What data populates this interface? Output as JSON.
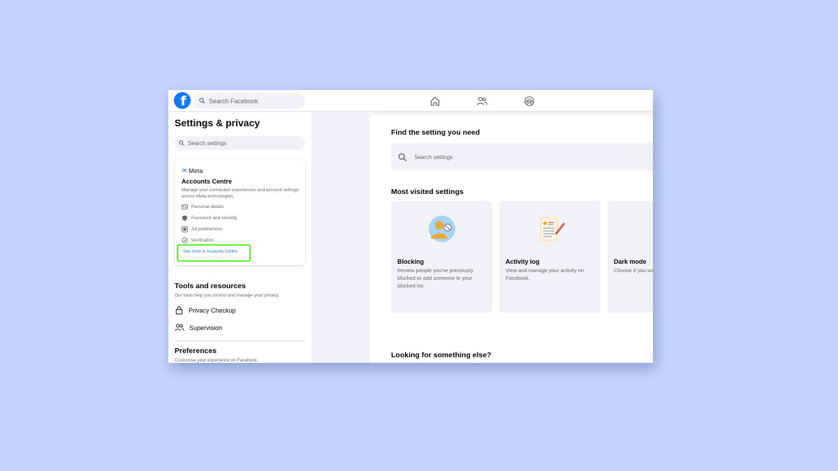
{
  "topbar": {
    "logo_letter": "f",
    "search_placeholder": "Search Facebook",
    "nav_icons": [
      "home-icon",
      "friends-icon",
      "groups-icon"
    ]
  },
  "sidebar": {
    "title": "Settings & privacy",
    "search_placeholder": "Search settings",
    "accounts_centre": {
      "brand": "Meta",
      "title": "Accounts Centre",
      "description": "Manage your connected experiences and account settings across Meta technologies.",
      "items": [
        {
          "label": "Personal details",
          "icon": "id-card-icon"
        },
        {
          "label": "Password and security",
          "icon": "shield-icon"
        },
        {
          "label": "Ad preferences",
          "icon": "ad-icon"
        },
        {
          "label": "Verification",
          "icon": "check-circle-icon"
        }
      ],
      "link": "See more in Accounts Centre"
    },
    "tools": {
      "title": "Tools and resources",
      "subtitle": "Our tools help you control and manage your privacy.",
      "items": [
        {
          "label": "Privacy Checkup",
          "icon": "lock-icon"
        },
        {
          "label": "Supervision",
          "icon": "people-icon"
        }
      ]
    },
    "preferences": {
      "title": "Preferences",
      "subtitle": "Customise your experience on Facebook."
    }
  },
  "main": {
    "find_title": "Find the setting you need",
    "search_placeholder": "Search settings",
    "most_visited_title": "Most visited settings",
    "cards": [
      {
        "title": "Blocking",
        "description": "Review people you've previously blocked or add someone to your blocked list."
      },
      {
        "title": "Activity log",
        "description": "View and manage your activity on Facebook."
      },
      {
        "title": "Dark mode",
        "description": "Choose if you want dark mode."
      }
    ],
    "looking_title": "Looking for something else?"
  },
  "colors": {
    "background": "#c5d4fc",
    "facebook_blue": "#1877f2",
    "highlight_green": "#5cf02e"
  }
}
